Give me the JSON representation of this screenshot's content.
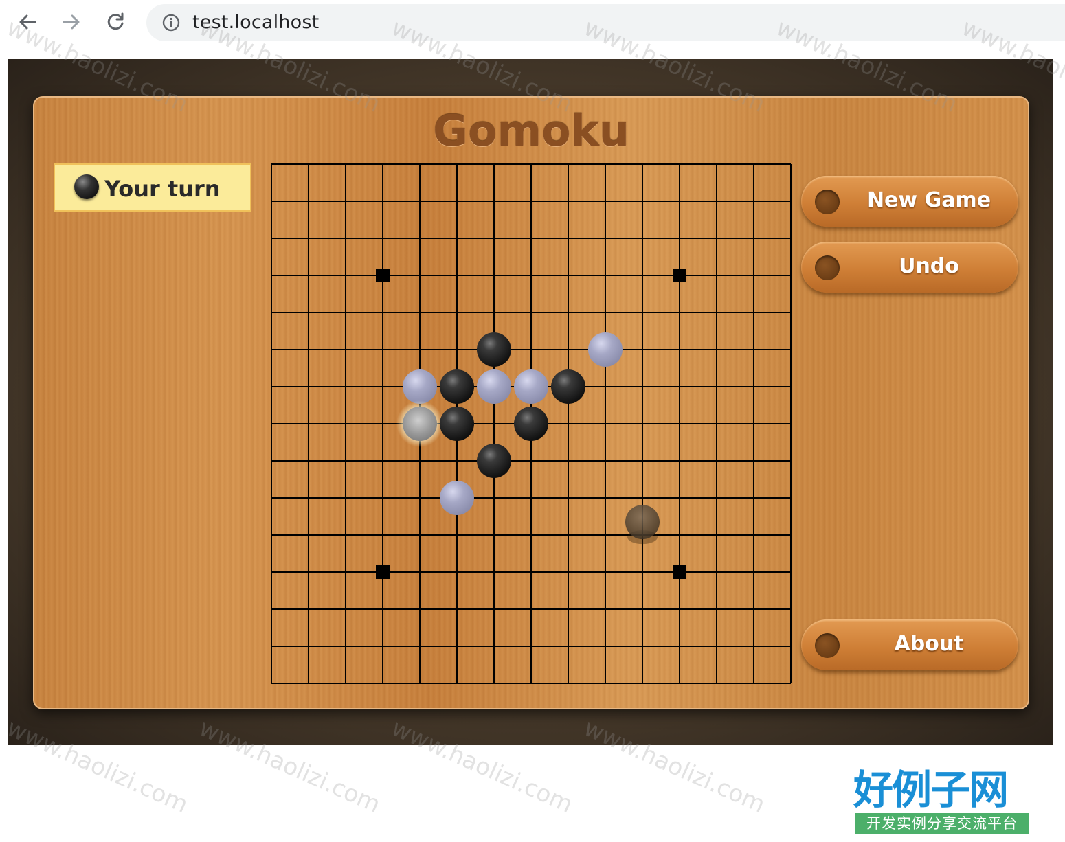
{
  "browser": {
    "url": "test.localhost",
    "back_icon": "arrow-left-icon",
    "forward_icon": "arrow-right-icon",
    "reload_icon": "reload-icon",
    "info_icon": "info-icon"
  },
  "game": {
    "title": "Gomoku",
    "turn_label": "Your turn",
    "board_size": 15,
    "star_points": [
      [
        3,
        3
      ],
      [
        3,
        11
      ],
      [
        11,
        3
      ],
      [
        11,
        11
      ]
    ],
    "stones": [
      {
        "color": "black",
        "row": 5,
        "col": 6
      },
      {
        "color": "white",
        "row": 5,
        "col": 9
      },
      {
        "color": "white",
        "row": 6,
        "col": 4
      },
      {
        "color": "black",
        "row": 6,
        "col": 5
      },
      {
        "color": "white",
        "row": 6,
        "col": 6
      },
      {
        "color": "white",
        "row": 6,
        "col": 7
      },
      {
        "color": "black",
        "row": 6,
        "col": 8
      },
      {
        "color": "white-highlight",
        "row": 7,
        "col": 4
      },
      {
        "color": "black",
        "row": 7,
        "col": 5
      },
      {
        "color": "black",
        "row": 7,
        "col": 7
      },
      {
        "color": "black",
        "row": 8,
        "col": 6
      },
      {
        "color": "white",
        "row": 9,
        "col": 5
      },
      {
        "color": "black-ghost",
        "row": 9.65,
        "col": 10
      }
    ],
    "buttons": {
      "new_game": "New Game",
      "undo": "Undo",
      "about": "About"
    },
    "colors": {
      "black_stone": "#2a2a2a",
      "white_stone": "#a8aac8",
      "button": "#cf7f36",
      "turn_box": "#fbeb9a",
      "title": "#8a4f22"
    }
  },
  "watermark": {
    "text": "www.haolizi.com",
    "logo_main": "好例子网",
    "logo_sub": "开发实例分享交流平台"
  }
}
